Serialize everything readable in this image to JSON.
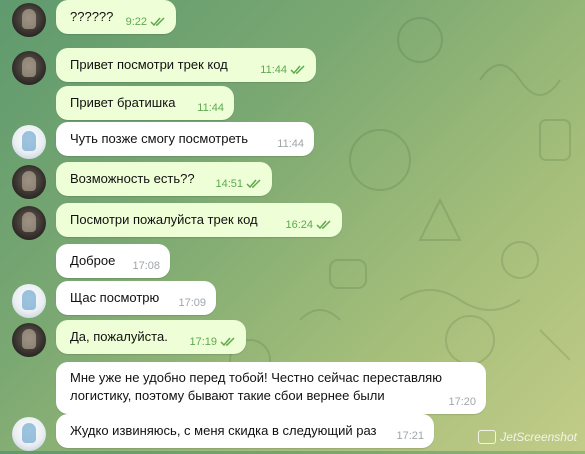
{
  "colors": {
    "outgoing_bubble": "#eefed6",
    "incoming_bubble": "#ffffff",
    "read_check": "#5fa94e",
    "time_incoming": "#a0a6ab"
  },
  "messages": [
    {
      "text": "??????",
      "time": "9:22",
      "direction": "out",
      "read": true,
      "avatar": "dark"
    },
    {
      "text": "Привет  посмотри трек код",
      "time": "11:44",
      "direction": "out",
      "read": true,
      "avatar": "dark"
    },
    {
      "text": "Привет братишка",
      "time": "11:44",
      "direction": "out",
      "read": false,
      "avatar": "none"
    },
    {
      "text": "Чуть позже смогу посмотреть",
      "time": "11:44",
      "direction": "in",
      "read": false,
      "avatar": "light"
    },
    {
      "text": "Возможность есть??",
      "time": "14:51",
      "direction": "out",
      "read": true,
      "avatar": "dark"
    },
    {
      "text": "Посмотри пожалуйста трек код",
      "time": "16:24",
      "direction": "out",
      "read": true,
      "avatar": "dark"
    },
    {
      "text": "Доброе",
      "time": "17:08",
      "direction": "in",
      "read": false,
      "avatar": "none"
    },
    {
      "text": "Щас посмотрю",
      "time": "17:09",
      "direction": "in",
      "read": false,
      "avatar": "light"
    },
    {
      "text": "Да, пожалуйста.",
      "time": "17:19",
      "direction": "out",
      "read": true,
      "avatar": "dark"
    },
    {
      "text": "Мне уже не удобно перед тобой! Честно сейчас переставляю логистику, поэтому бывают такие сбои вернее были",
      "time": "17:20",
      "direction": "in",
      "read": false,
      "avatar": "none"
    },
    {
      "text": "Жудко извиняюсь, с меня скидка в следующий раз",
      "time": "17:21",
      "direction": "in",
      "read": false,
      "avatar": "light"
    }
  ],
  "watermark": {
    "text": "JetScreenshot",
    "icon": "camera-icon"
  }
}
